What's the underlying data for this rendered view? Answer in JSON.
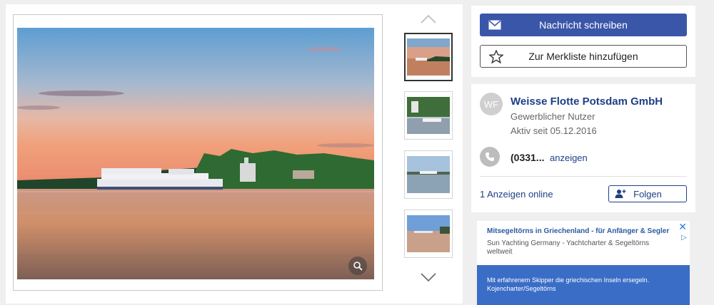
{
  "gallery": {
    "main_image_icon": "sunset-boat-photo",
    "zoom_icon": "magnifier-icon",
    "nav_up_icon": "chevron-up-icon",
    "nav_down_icon": "chevron-down-icon",
    "thumbnails": [
      {
        "icon": "sunset-boat-photo",
        "selected": true
      },
      {
        "icon": "castle-boat-photo",
        "selected": false
      },
      {
        "icon": "river-boat-photo",
        "selected": false
      },
      {
        "icon": "lake-boat-photo",
        "selected": false
      }
    ]
  },
  "actions": {
    "message_label": "Nachricht schreiben",
    "message_icon": "envelope-icon",
    "watchlist_label": "Zur Merkliste hinzufügen",
    "watchlist_icon": "star-outline-icon"
  },
  "seller": {
    "avatar_initials": "WF",
    "name": "Weisse Flotte Potsdam GmbH",
    "type": "Gewerblicher Nutzer",
    "active_since": "Aktiv seit 05.12.2016",
    "phone_prefix": "(0331...",
    "phone_reveal": "anzeigen",
    "phone_icon": "phone-icon",
    "ads_online": "1 Anzeigen online",
    "follow_label": "Folgen",
    "follow_icon": "add-user-icon"
  },
  "ad": {
    "title": "Mitsegeltörns in Griechenland - für Anfänger & Segler",
    "description": "Sun Yachting Germany - Yachtcharter & Segeltörns weltweit",
    "banner_text": "Mit erfahrenem Skipper die griechischen Inseln ersegeln. Kojencharter/Segeltörns",
    "close_symbol": "✕",
    "info_symbol": "▷"
  },
  "colors": {
    "primary": "#3a56a8",
    "link": "#1e3f85",
    "ad_blue": "#3a6dc6"
  }
}
